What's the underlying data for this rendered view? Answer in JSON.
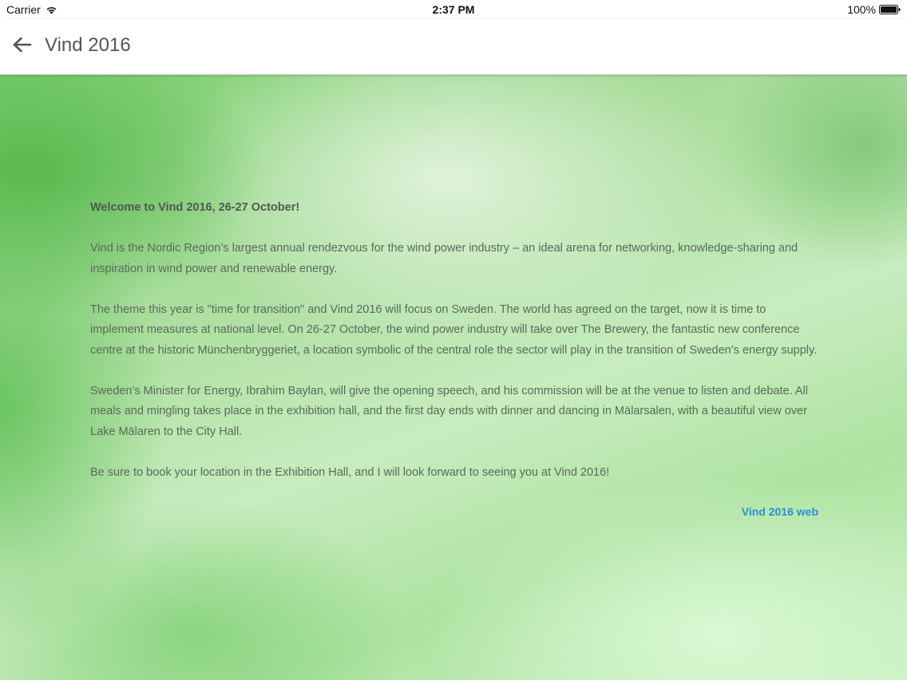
{
  "status_bar": {
    "carrier": "Carrier",
    "time": "2:37 PM",
    "battery": "100%"
  },
  "nav": {
    "title": "Vind 2016",
    "back_icon": "arrow-left-icon"
  },
  "content": {
    "heading": "Welcome to Vind 2016, 26-27 October!",
    "paragraphs": [
      "Vind is the Nordic Region’s largest annual rendezvous for the wind power industry – an ideal arena for networking, knowledge-sharing and inspiration in wind power and renewable energy.",
      "The theme this year is \"time for transition\" and Vind 2016 will focus on Sweden. The world has agreed on the target, now it is time to implement measures at national level. On 26-27 October, the wind power industry will take over The Brewery, the fantastic new conference centre at the historic Münchenbryggeriet, a location symbolic of the central role the sector will play in the transition of Sweden’s energy supply.",
      "Sweden’s Minister for Energy, Ibrahim Baylan, will give the opening speech, and his commission will be at the venue to listen and debate. All meals and mingling takes place in the exhibition hall, and the first day ends with dinner and dancing in Mälarsalen, with a beautiful view over Lake Mälaren to the City Hall.",
      "Be sure to book your location in the Exhibition Hall, and I will look forward to seeing you at Vind 2016!"
    ],
    "link_label": "Vind 2016 web"
  },
  "colors": {
    "link": "#2a8fd8",
    "text": "#5a6a5a",
    "title": "#555555"
  }
}
